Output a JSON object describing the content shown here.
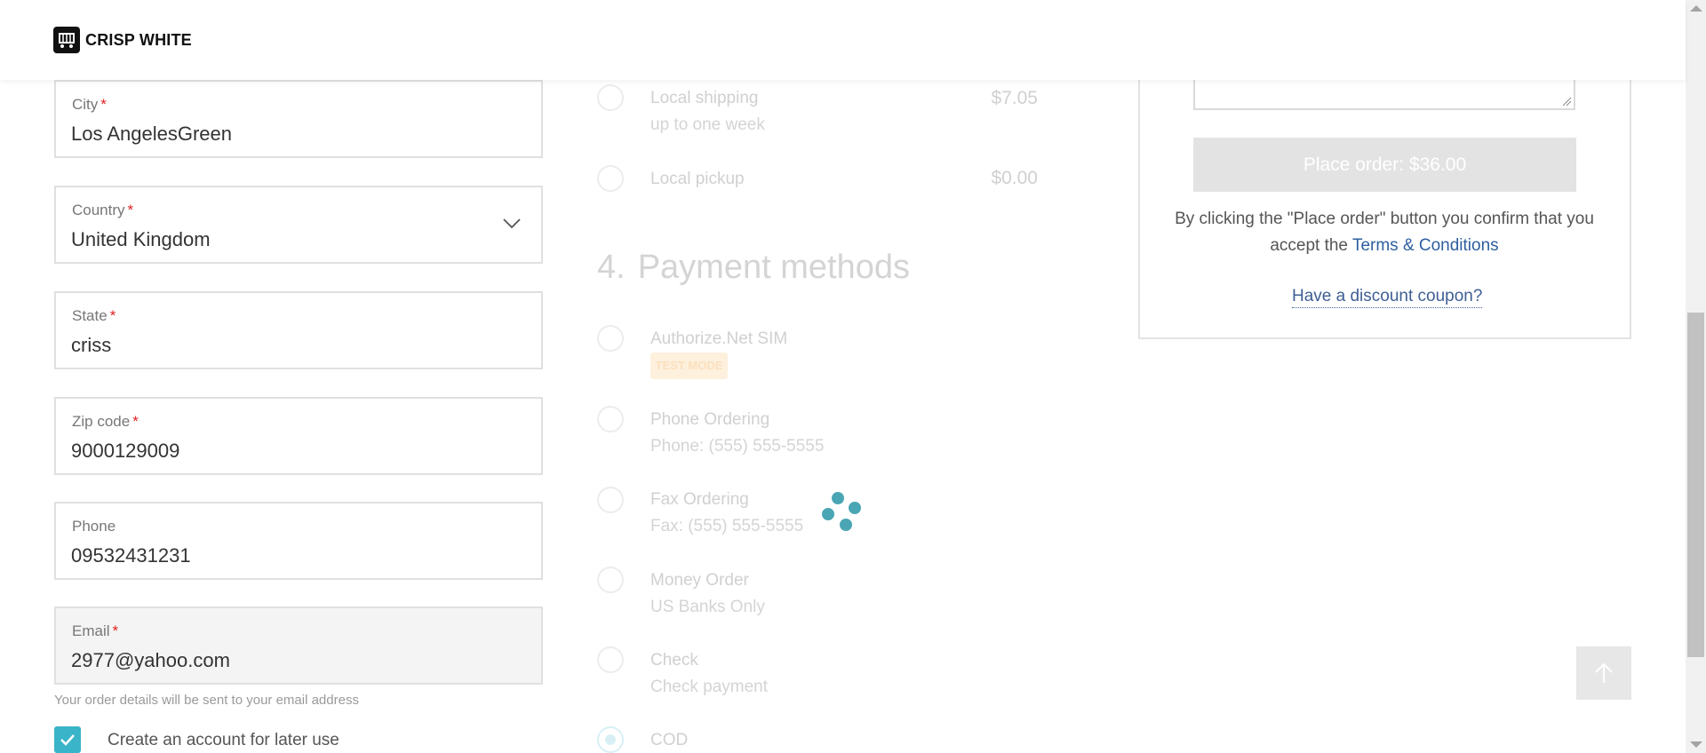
{
  "header": {
    "brand": "CRISP WHITE"
  },
  "form": {
    "city": {
      "label": "City",
      "value": "Los AngelesGreen",
      "required": "*"
    },
    "country": {
      "label": "Country",
      "value": "United Kingdom",
      "required": "*"
    },
    "state": {
      "label": "State",
      "value": "criss",
      "required": "*"
    },
    "zip": {
      "label": "Zip code",
      "value": "9000129009",
      "required": "*"
    },
    "phone": {
      "label": "Phone",
      "value": "09532431231"
    },
    "email": {
      "label": "Email",
      "value": "2977@yahoo.com",
      "required": "*"
    },
    "email_hint": "Your order details will be sent to your email address",
    "create_account": {
      "label": "Create an account for later use",
      "checked": true
    }
  },
  "shipping": {
    "options": [
      {
        "title": "Local shipping",
        "subtitle": "up to one week",
        "price": "$7.05"
      },
      {
        "title": "Local pickup",
        "price": "$0.00"
      }
    ]
  },
  "payment": {
    "step_number": "4.",
    "title": "Payment methods",
    "options": [
      {
        "title": "Authorize.Net SIM",
        "badge": "TEST MODE"
      },
      {
        "title": "Phone Ordering",
        "subtitle": "Phone: (555) 555-5555"
      },
      {
        "title": "Fax Ordering",
        "subtitle": "Fax: (555) 555-5555"
      },
      {
        "title": "Money Order",
        "subtitle": "US Banks Only"
      },
      {
        "title": "Check",
        "subtitle": "Check payment"
      },
      {
        "title": "COD",
        "selected": true
      }
    ]
  },
  "summary": {
    "place_order": "Place order: $36.00",
    "confirm_text": "By clicking the \"Place order\" button you confirm that you accept the",
    "terms_link": "Terms & Conditions",
    "coupon_link": "Have a discount coupon?"
  },
  "colors": {
    "accent": "#3ab4c8",
    "spinner": "#4aa6b4",
    "link": "#2e5fa0",
    "required": "#e02020"
  }
}
